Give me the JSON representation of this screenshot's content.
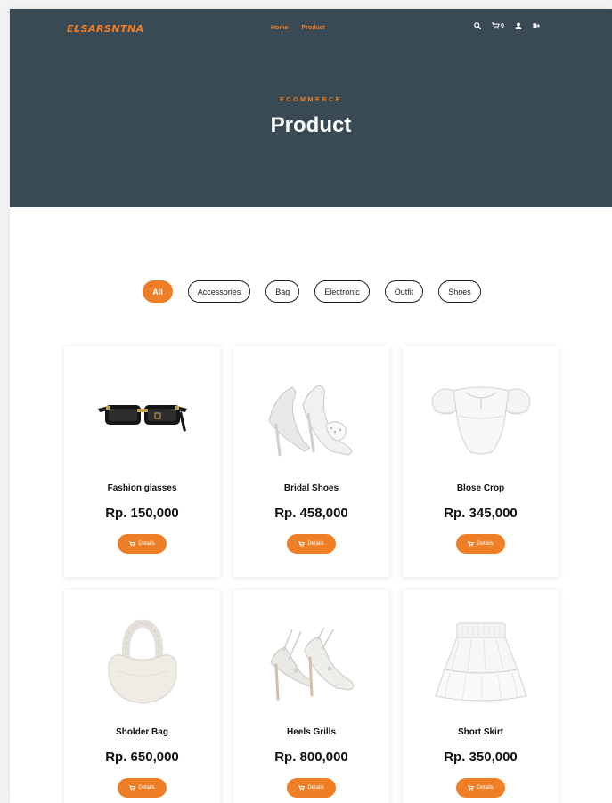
{
  "header": {
    "logo": "ELSARSNTNA",
    "nav": [
      "Home",
      "Product"
    ],
    "cart_count": "0"
  },
  "hero": {
    "eyebrow": "ECOMMERCE",
    "title": "Product"
  },
  "filters": [
    {
      "label": "All",
      "active": true
    },
    {
      "label": "Accessories",
      "active": false
    },
    {
      "label": "Bag",
      "active": false
    },
    {
      "label": "Electronic",
      "active": false
    },
    {
      "label": "Outfit",
      "active": false
    },
    {
      "label": "Shoes",
      "active": false
    }
  ],
  "products": [
    {
      "name": "Fashion glasses",
      "price": "Rp. 150,000",
      "image": "sunglasses-image",
      "button": "Details"
    },
    {
      "name": "Bridal Shoes",
      "price": "Rp. 458,000",
      "image": "bridal-heels-image",
      "button": "Details"
    },
    {
      "name": "Blose Crop",
      "price": "Rp. 345,000",
      "image": "crop-blouse-image",
      "button": "Details"
    },
    {
      "name": "Sholder Bag",
      "price": "Rp. 650,000",
      "image": "shoulder-bag-image",
      "button": "Details"
    },
    {
      "name": "Heels Grills",
      "price": "Rp. 800,000",
      "image": "strappy-heels-image",
      "button": "Details"
    },
    {
      "name": "Short Skirt",
      "price": "Rp. 350,000",
      "image": "tiered-skirt-image",
      "button": "Details"
    }
  ],
  "colors": {
    "accent": "#ee7f27",
    "hero_bg": "#394a54",
    "page_bg": "#ffffff"
  }
}
